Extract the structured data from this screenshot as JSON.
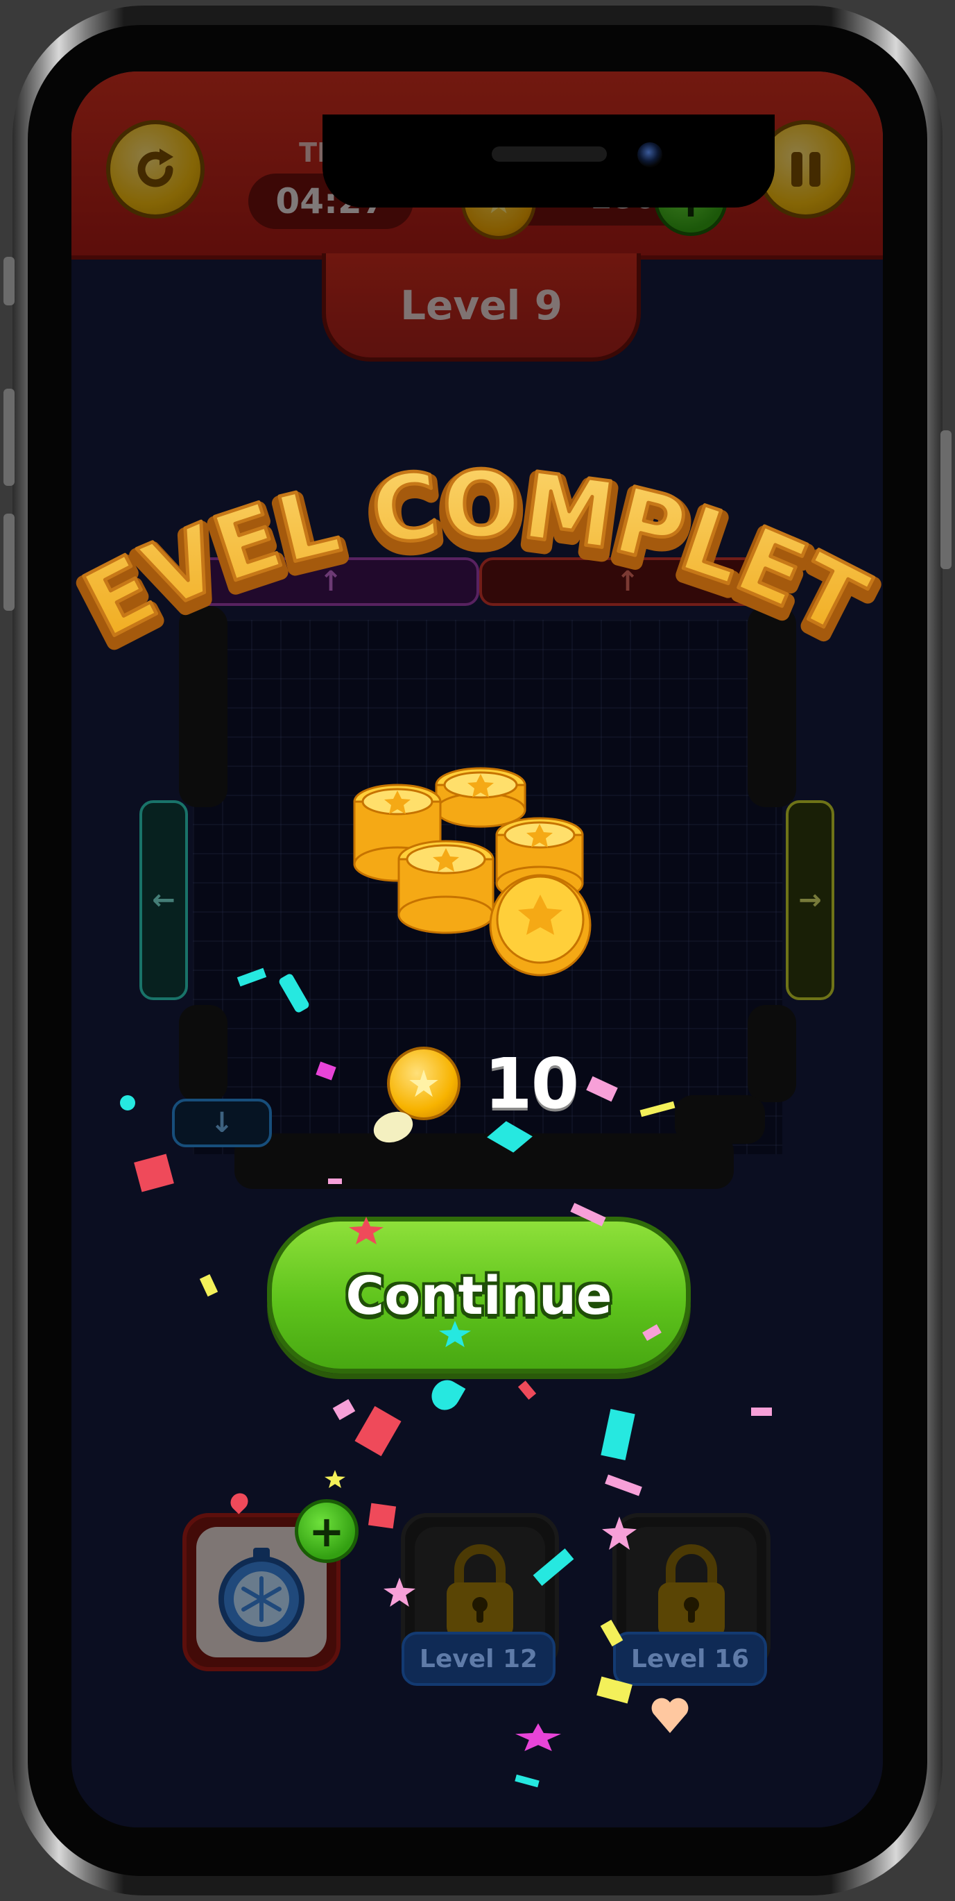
{
  "hud": {
    "time_label": "TIME",
    "timer": "04:27",
    "coins": "180",
    "level_title": "Level 9"
  },
  "overlay": {
    "headline": "LEVEL COMPLETE",
    "reward_amount": "10",
    "continue_label": "Continue"
  },
  "boosters": [
    {
      "name": "freeze-timer",
      "locked": false
    },
    {
      "name": "locked-booster-1",
      "locked": true,
      "unlock_label": "Level 12"
    },
    {
      "name": "locked-booster-2",
      "locked": true,
      "unlock_label": "Level 16"
    }
  ],
  "colors": {
    "hud_red": "#c92a1c",
    "gold": "#f2b90b",
    "continue_green": "#5ec31c",
    "background": "#141a3d"
  },
  "icons": [
    "restart-icon",
    "pause-icon",
    "star-coin-icon",
    "plus-icon",
    "arrow-up-icon",
    "arrow-left-icon",
    "arrow-right-icon",
    "arrow-down-icon",
    "stopwatch-icon",
    "lock-icon"
  ]
}
